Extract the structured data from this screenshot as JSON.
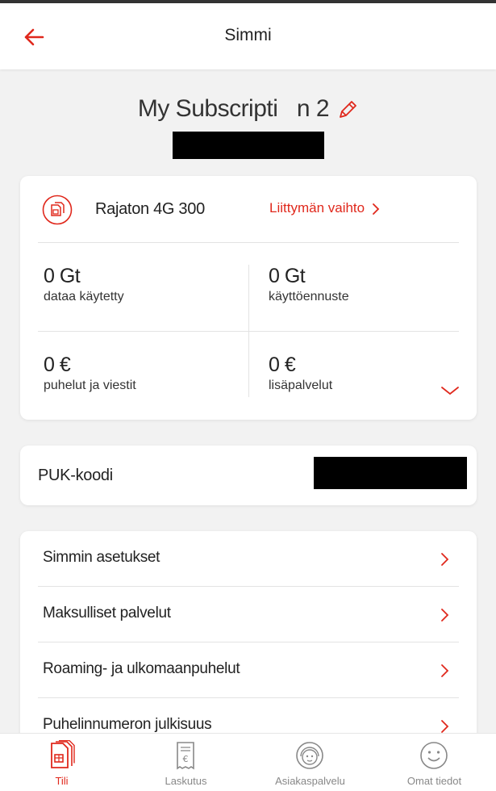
{
  "header": {
    "title": "Simmi",
    "back_icon": "back-arrow-icon",
    "accent": "#e0281c"
  },
  "subscription": {
    "title": "My Subscripti   n 2",
    "edit_icon": "pencil-icon"
  },
  "plan": {
    "icon": "sim-card-icon",
    "name": "Rajaton 4G 300",
    "change_label": "Liittymän vaihto",
    "stats": [
      {
        "value": "0 Gt",
        "label": "dataa käytetty"
      },
      {
        "value": "0 Gt",
        "label": "käyttöennuste"
      },
      {
        "value": "0 €",
        "label": "puhelut ja viestit"
      },
      {
        "value": "0 €",
        "label": "lisäpalvelut"
      }
    ]
  },
  "puk": {
    "label": "PUK-koodi"
  },
  "menu": {
    "items": [
      {
        "label": "Simmin asetukset"
      },
      {
        "label": "Maksulliset palvelut"
      },
      {
        "label": "Roaming- ja ulkomaanpuhelut"
      },
      {
        "label": "Puhelinnumeron julkisuus"
      }
    ]
  },
  "bottom_nav": {
    "items": [
      {
        "label": "Tili",
        "icon": "sim-card-icon",
        "active": true
      },
      {
        "label": "Laskutus",
        "icon": "receipt-icon",
        "active": false
      },
      {
        "label": "Asiakaspalvelu",
        "icon": "customer-service-icon",
        "active": false
      },
      {
        "label": "Omat tiedot",
        "icon": "smiley-icon",
        "active": false
      }
    ]
  }
}
